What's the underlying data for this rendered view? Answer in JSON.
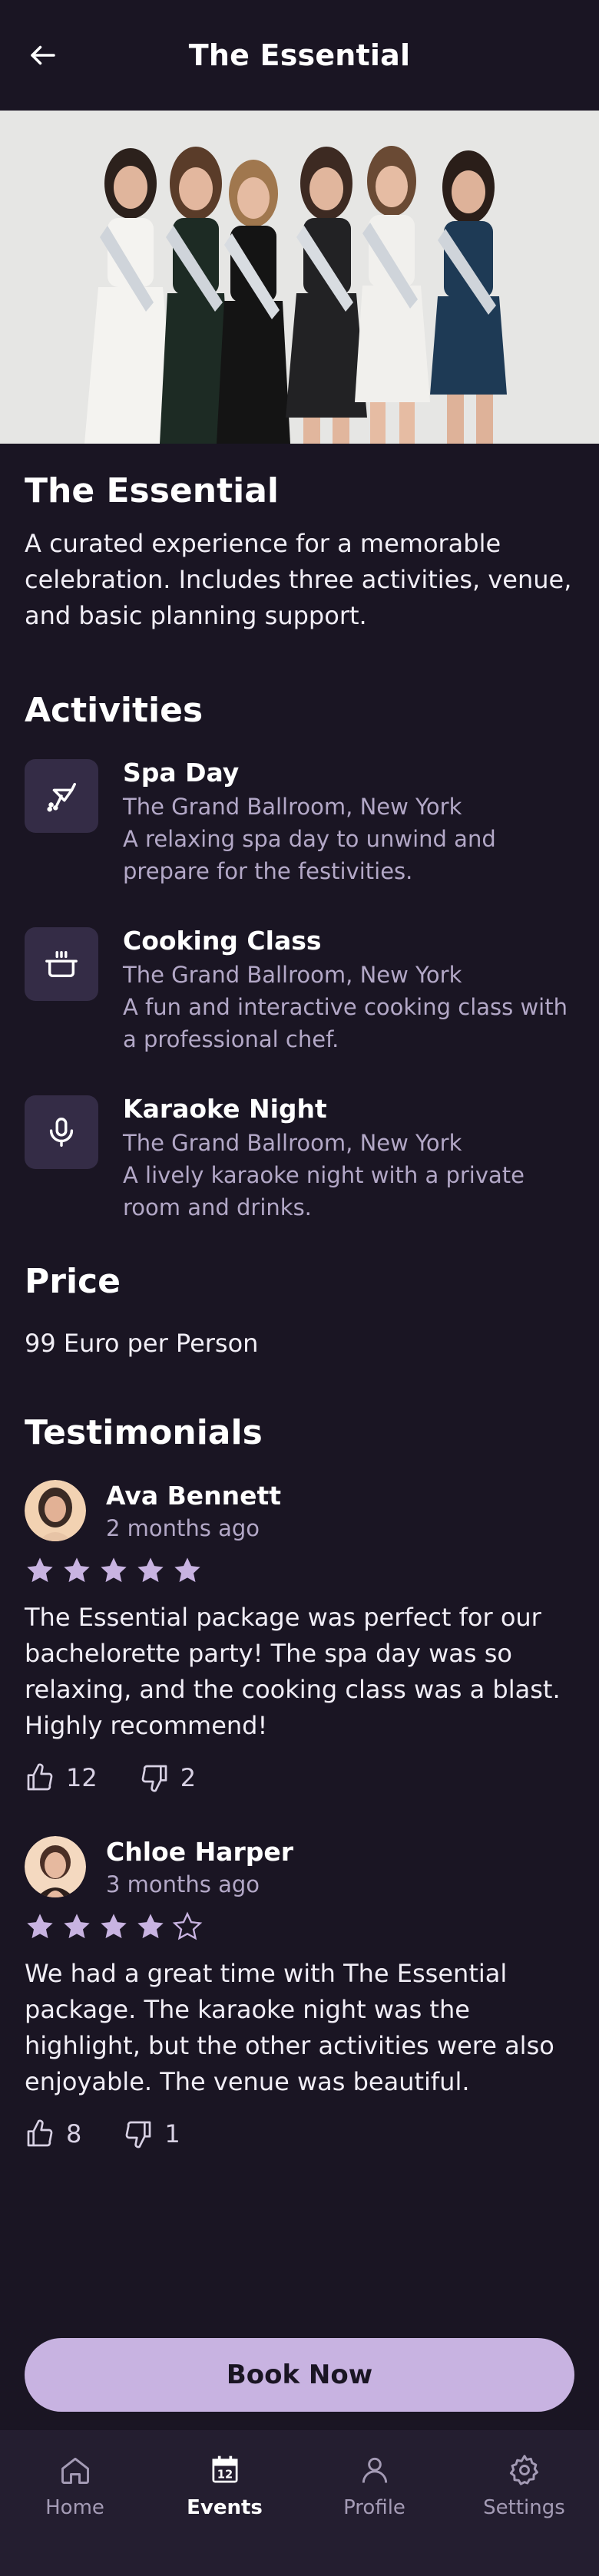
{
  "header": {
    "title": "The Essential"
  },
  "package": {
    "title": "The Essential",
    "description": "A curated experience for a memorable celebration. Includes three activities, venue, and basic planning support."
  },
  "activities_title": "Activities",
  "activities": [
    {
      "icon": "spa-icon",
      "title": "Spa Day",
      "location": "The Grand Ballroom, New York",
      "description": "A relaxing spa day to unwind and prepare for the festivities."
    },
    {
      "icon": "cooking-pot-icon",
      "title": "Cooking Class",
      "location": "The Grand Ballroom, New York",
      "description": "A fun and interactive cooking class with a professional chef."
    },
    {
      "icon": "microphone-icon",
      "title": "Karaoke Night",
      "location": "The Grand Ballroom, New York",
      "description": "A lively karaoke night with a private room and drinks."
    }
  ],
  "price": {
    "title": "Price",
    "text": "99 Euro per Person"
  },
  "testimonials_title": "Testimonials",
  "testimonials": [
    {
      "name": "Ava Bennett",
      "time": "2 months ago",
      "rating": 5,
      "text": "The Essential package was perfect for our bachelorette party! The spa day was so relaxing, and the cooking class was a blast. Highly recommend!",
      "likes": "12",
      "dislikes": "2"
    },
    {
      "name": "Chloe Harper",
      "time": "3 months ago",
      "rating": 4,
      "text": "We had a great time with The Essential package. The karaoke night was the highlight, but the other activities were also enjoyable. The venue was beautiful.",
      "likes": "8",
      "dislikes": "1"
    }
  ],
  "book_button": "Book Now",
  "nav": {
    "items": [
      {
        "label": "Home",
        "icon": "home-icon",
        "active": false
      },
      {
        "label": "Events",
        "icon": "calendar-icon",
        "active": true,
        "badge": "12"
      },
      {
        "label": "Profile",
        "icon": "user-icon",
        "active": false
      },
      {
        "label": "Settings",
        "icon": "gear-icon",
        "active": false
      }
    ]
  },
  "colors": {
    "background": "#1a1523",
    "accent": "#c8b3e1",
    "icon_tile": "#342c46",
    "muted_text": "#b3a8c7"
  }
}
